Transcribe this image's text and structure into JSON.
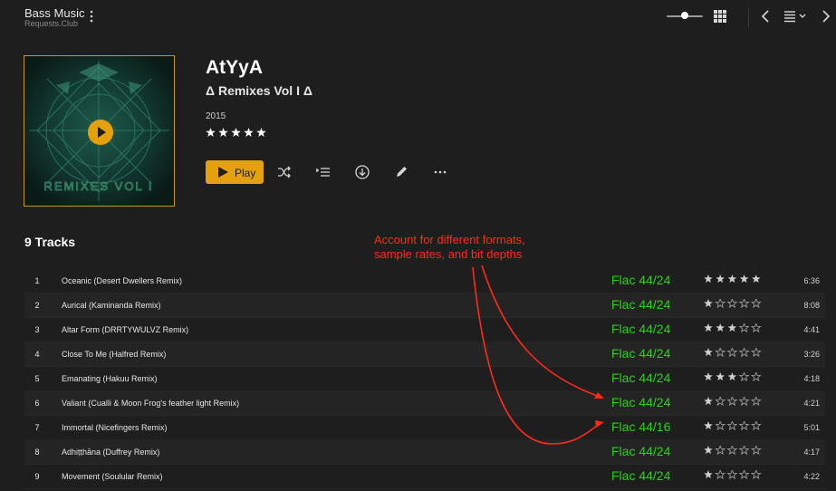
{
  "header": {
    "title": "Bass Music",
    "subtitle": "Requests.Club",
    "size_slider_value": 0.5
  },
  "album": {
    "artist": "AtYyA",
    "title": "Δ Remixes Vol I Δ",
    "year": "2015",
    "rating": 5,
    "cover_text": "REMIXES VOL I"
  },
  "actions": {
    "play_label": "Play",
    "icons": [
      "shuffle-icon",
      "add-to-queue-icon",
      "download-icon",
      "edit-icon",
      "more-icon"
    ]
  },
  "tracks_heading": "9 Tracks",
  "annotation": {
    "line1": "Account for different formats,",
    "line2": "sample rates, and bit depths"
  },
  "colors": {
    "accent": "#e5a00d",
    "format_text": "#2fce1f",
    "annotation": "#ff2a1a",
    "background": "#1e1e1e"
  },
  "tracks": [
    {
      "num": "1",
      "title": "Oceanic (Desert Dwellers Remix)",
      "format": "Flac 44/24",
      "rating": 5,
      "duration": "6:36"
    },
    {
      "num": "2",
      "title": "Aurical (Kaminanda Remix)",
      "format": "Flac 44/24",
      "rating": 1,
      "duration": "8:08"
    },
    {
      "num": "3",
      "title": "Altar Form (DRRTYWULVZ Remix)",
      "format": "Flac 44/24",
      "rating": 3,
      "duration": "4:41"
    },
    {
      "num": "4",
      "title": "Close To Me (Halfred Remix)",
      "format": "Flac 44/24",
      "rating": 1,
      "duration": "3:26"
    },
    {
      "num": "5",
      "title": "Emanating (Hakuu Remix)",
      "format": "Flac 44/24",
      "rating": 3,
      "duration": "4:18"
    },
    {
      "num": "6",
      "title": "Valiant (Cualli & Moon Frog's feather light Remix)",
      "format": "Flac 44/24",
      "rating": 1,
      "duration": "4:21"
    },
    {
      "num": "7",
      "title": "Immortal (Nicefingers Remix)",
      "format": "Flac 44/16",
      "rating": 1,
      "duration": "5:01"
    },
    {
      "num": "8",
      "title": "Adhiṭṭhāna (Duffrey Remix)",
      "format": "Flac 44/24",
      "rating": 1,
      "duration": "4:17"
    },
    {
      "num": "9",
      "title": "Movement (Soulular Remix)",
      "format": "Flac 44/24",
      "rating": 1,
      "duration": "4:22"
    }
  ]
}
